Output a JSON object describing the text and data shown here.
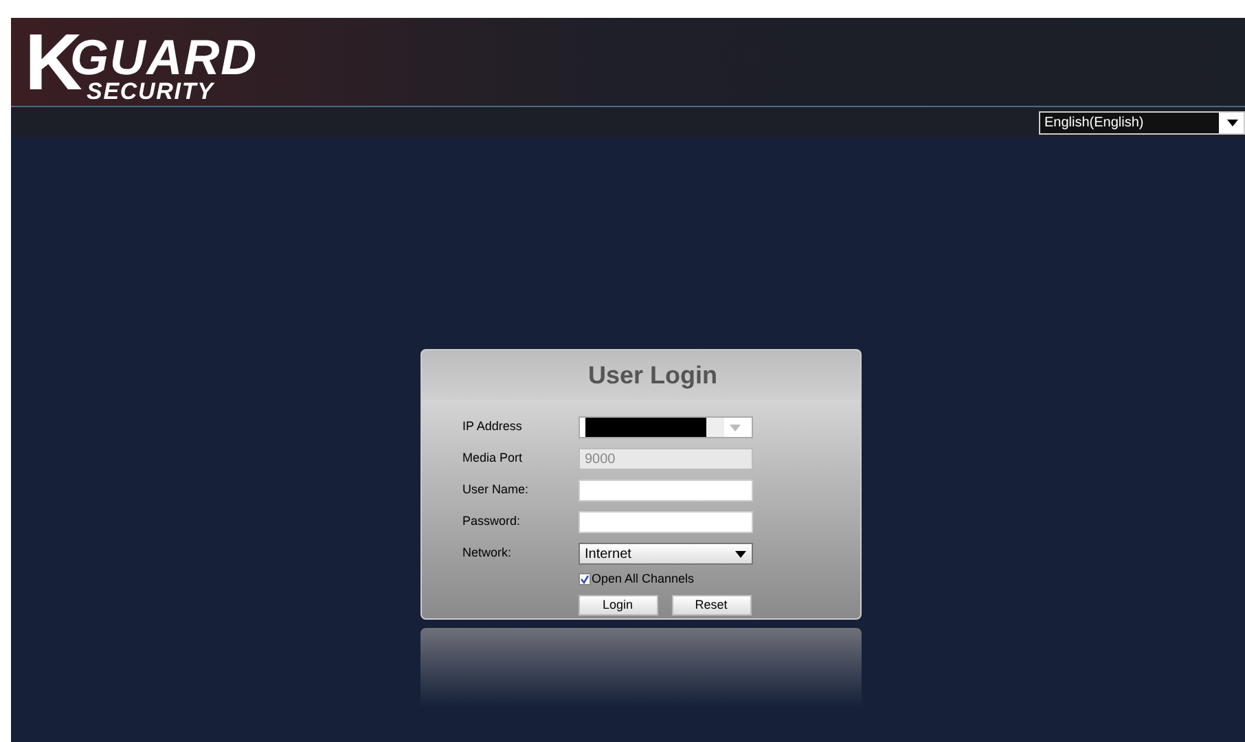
{
  "logo": {
    "mark": "K",
    "name": "GUARD",
    "tagline": "SECURITY"
  },
  "language_select": {
    "value": "English(English)"
  },
  "login": {
    "title": "User Login",
    "fields": [
      {
        "label": "IP Address",
        "kind": "combo",
        "redacted": true
      },
      {
        "label": "Media Port",
        "kind": "readonly",
        "value": "9000"
      },
      {
        "label": "User Name:",
        "kind": "text"
      },
      {
        "label": "Password:",
        "kind": "password"
      },
      {
        "label": "Network:",
        "kind": "select",
        "value": "Internet"
      }
    ],
    "open_all_channels": {
      "label": "Open All Channels",
      "checked": true
    },
    "buttons": [
      "Login",
      "Reset"
    ]
  }
}
